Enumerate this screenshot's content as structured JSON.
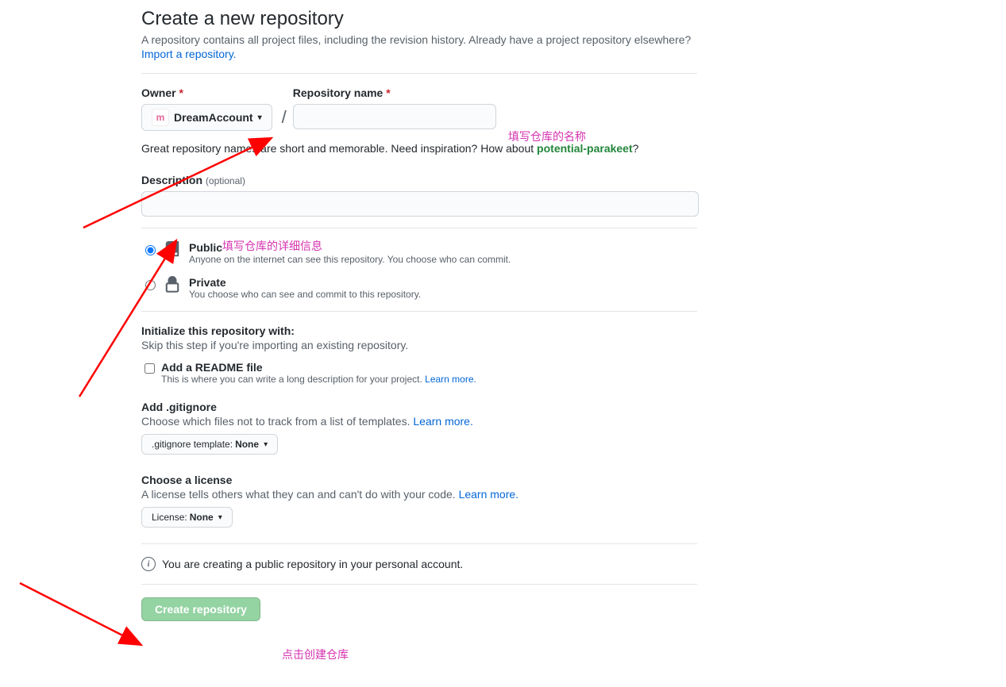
{
  "header": {
    "title": "Create a new repository",
    "subtitle": "A repository contains all project files, including the revision history. Already have a project repository elsewhere?",
    "import_link": "Import a repository."
  },
  "owner": {
    "label": "Owner",
    "value": "DreamAccount"
  },
  "repo_name": {
    "label": "Repository name"
  },
  "hint": {
    "text_before": "Great repository names are short and memorable. Need inspiration? How about ",
    "suggestion": "potential-parakeet",
    "text_after": "?"
  },
  "description": {
    "label": "Description",
    "optional": "(optional)"
  },
  "visibility": {
    "public": {
      "title": "Public",
      "desc": "Anyone on the internet can see this repository. You choose who can commit."
    },
    "private": {
      "title": "Private",
      "desc": "You choose who can see and commit to this repository."
    }
  },
  "init": {
    "title": "Initialize this repository with:",
    "subtitle": "Skip this step if you're importing an existing repository.",
    "readme": {
      "title": "Add a README file",
      "desc_before": "This is where you can write a long description for your project. ",
      "learn": "Learn more."
    },
    "gitignore": {
      "title": "Add .gitignore",
      "desc_before": "Choose which files not to track from a list of templates. ",
      "learn": "Learn more.",
      "btn_prefix": ".gitignore template: ",
      "btn_value": "None"
    },
    "license": {
      "title": "Choose a license",
      "desc_before": "A license tells others what they can and can't do with your code. ",
      "learn": "Learn more.",
      "btn_prefix": "License: ",
      "btn_value": "None"
    }
  },
  "info": "You are creating a public repository in your personal account.",
  "create_btn": "Create repository",
  "annotations": {
    "a1": "填写仓库的名称",
    "a2": "填写仓库的详细信息",
    "a3": "点击创建仓库"
  }
}
